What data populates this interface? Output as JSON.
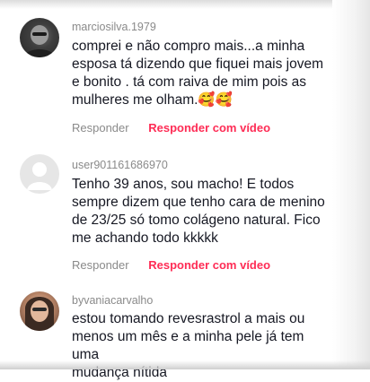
{
  "comments": [
    {
      "username": "marciosilva.1979",
      "text": "comprei e não compro mais...a minha\nesposa tá dizendo que fiquei mais jovem\ne bonito . tá com raiva de mim pois as\nmulheres me olham.🥰🥰",
      "reply_label": "Responder",
      "reply_video_label": "Responder com vídeo"
    },
    {
      "username": "user901161686970",
      "text": "Tenho 39 anos, sou macho! E todos\nsempre dizem que tenho cara de menino\nde 23/25 só tomo colágeno natural. Fico\nme achando todo kkkkk",
      "reply_label": "Responder",
      "reply_video_label": "Responder com vídeo"
    },
    {
      "username": "byvaniacarvalho",
      "text": "estou tomando revesrastrol a mais ou\nmenos um mês e a minha pele já tem uma\nmudança nítida"
    }
  ],
  "colors": {
    "accent": "#fe2c55",
    "meta": "#8a8a8a",
    "text": "#161823"
  }
}
